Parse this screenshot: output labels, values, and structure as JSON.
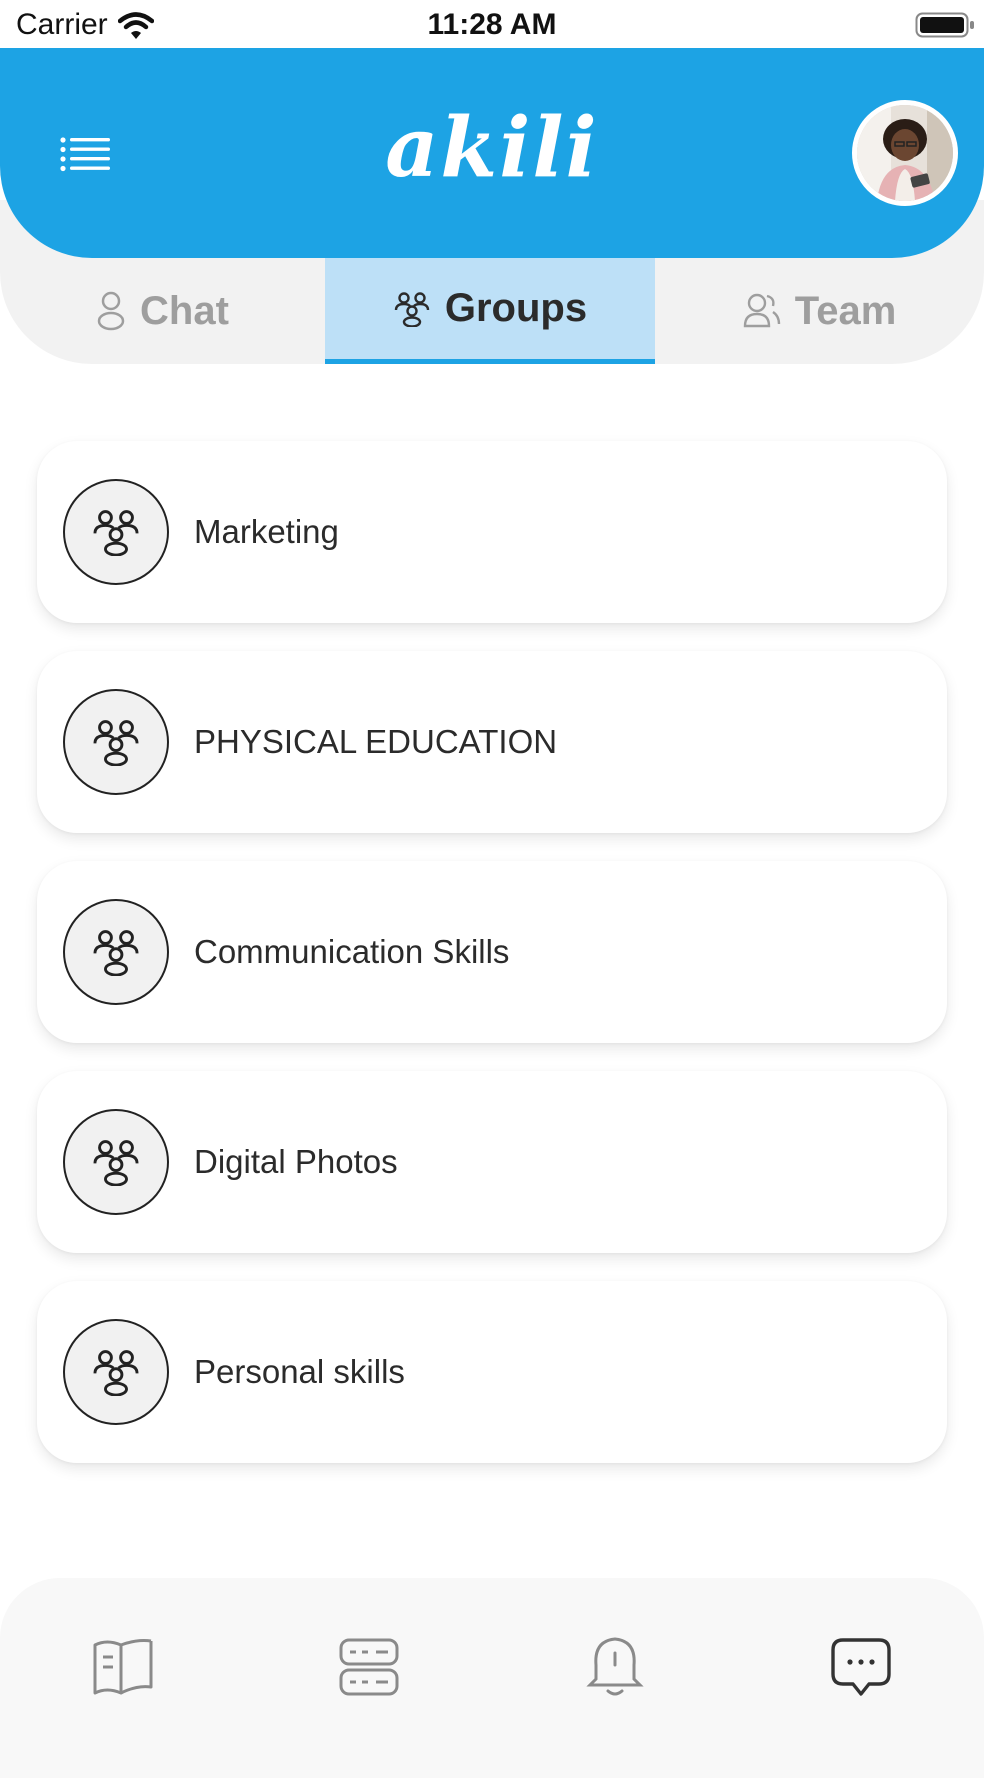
{
  "status_bar": {
    "carrier": "Carrier",
    "time": "11:28 AM"
  },
  "header": {
    "logo_text": "akili",
    "brand_color": "#1da3e4"
  },
  "tabs": [
    {
      "label": "Chat",
      "icon": "person-icon",
      "active": false
    },
    {
      "label": "Groups",
      "icon": "group-icon",
      "active": true
    },
    {
      "label": "Team",
      "icon": "team-icon",
      "active": false
    }
  ],
  "groups": [
    {
      "name": "Marketing",
      "icon": "group-icon"
    },
    {
      "name": "PHYSICAL EDUCATION",
      "icon": "group-icon"
    },
    {
      "name": "Communication Skills",
      "icon": "group-icon"
    },
    {
      "name": "Digital Photos",
      "icon": "group-icon"
    },
    {
      "name": "Personal skills",
      "icon": "group-icon"
    }
  ],
  "bottom_nav": [
    {
      "icon": "book-icon",
      "active": false
    },
    {
      "icon": "courses-icon",
      "active": false
    },
    {
      "icon": "bell-icon",
      "active": false
    },
    {
      "icon": "chat-bubble-icon",
      "active": true
    }
  ]
}
